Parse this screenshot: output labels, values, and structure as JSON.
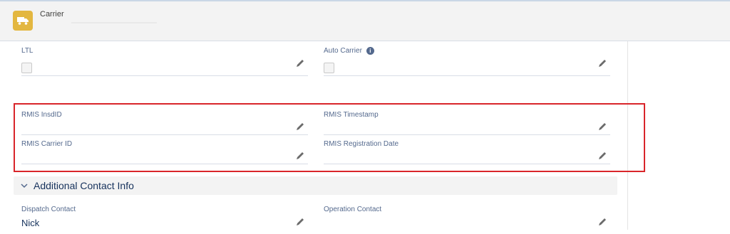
{
  "header": {
    "object_label": "Carrier",
    "icon": "truck-icon",
    "icon_color": "#e3b740"
  },
  "fields": {
    "ltl": {
      "label": "LTL",
      "checked": false
    },
    "auto_carrier": {
      "label": "Auto Carrier",
      "checked": false,
      "info_icon": "info-icon"
    },
    "rmis_insdid": {
      "label": "RMIS InsdID",
      "value": ""
    },
    "rmis_timestamp": {
      "label": "RMIS Timestamp",
      "value": ""
    },
    "rmis_carrier_id": {
      "label": "RMIS Carrier ID",
      "value": ""
    },
    "rmis_registration_date": {
      "label": "RMIS Registration Date",
      "value": ""
    }
  },
  "section": {
    "title": "Additional Contact Info",
    "expanded": true
  },
  "contact": {
    "dispatch": {
      "label": "Dispatch Contact",
      "value": "Nick"
    },
    "operation": {
      "label": "Operation Contact",
      "value": ""
    }
  },
  "colors": {
    "highlight": "#d9252a",
    "label": "#54698d",
    "value": "#16325c"
  }
}
